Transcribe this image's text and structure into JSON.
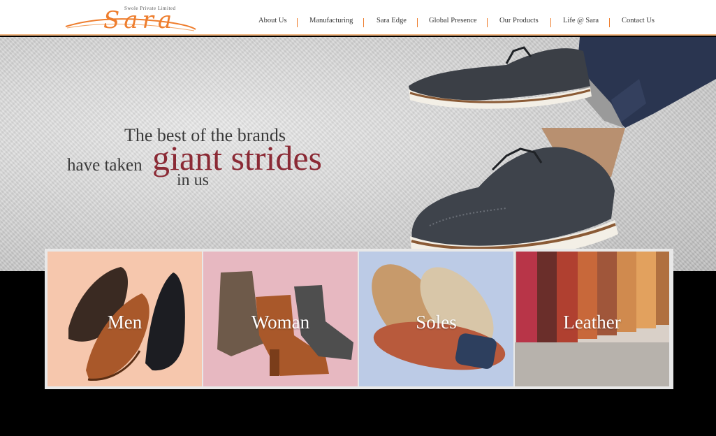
{
  "brand": {
    "name": "Sara",
    "tagline": "Swole Private Limited",
    "accent_color": "#ee7d2d"
  },
  "nav": {
    "items": [
      {
        "label": "About Us"
      },
      {
        "label": "Manufacturing"
      },
      {
        "label": "Sara Edge"
      },
      {
        "label": "Global Presence"
      },
      {
        "label": "Our Products"
      },
      {
        "label": "Life @ Sara"
      },
      {
        "label": "Contact Us"
      }
    ]
  },
  "hero": {
    "line1": "The best of the brands",
    "line2": "have taken",
    "highlight": "giant strides",
    "line3": "in us",
    "highlight_color": "#8b2a35",
    "image": "brogue-shoes-photo"
  },
  "categories": [
    {
      "label": "Men",
      "background": "#f6c7ad",
      "image": "mens-shoes-photo"
    },
    {
      "label": "Woman",
      "background": "#e7b8c1",
      "image": "womens-boots-photo"
    },
    {
      "label": "Soles",
      "background": "#bccbe6",
      "image": "shoe-soles-photo"
    },
    {
      "label": "Leather",
      "background": "#d9d0c8",
      "image": "leather-rolls-photo"
    }
  ]
}
